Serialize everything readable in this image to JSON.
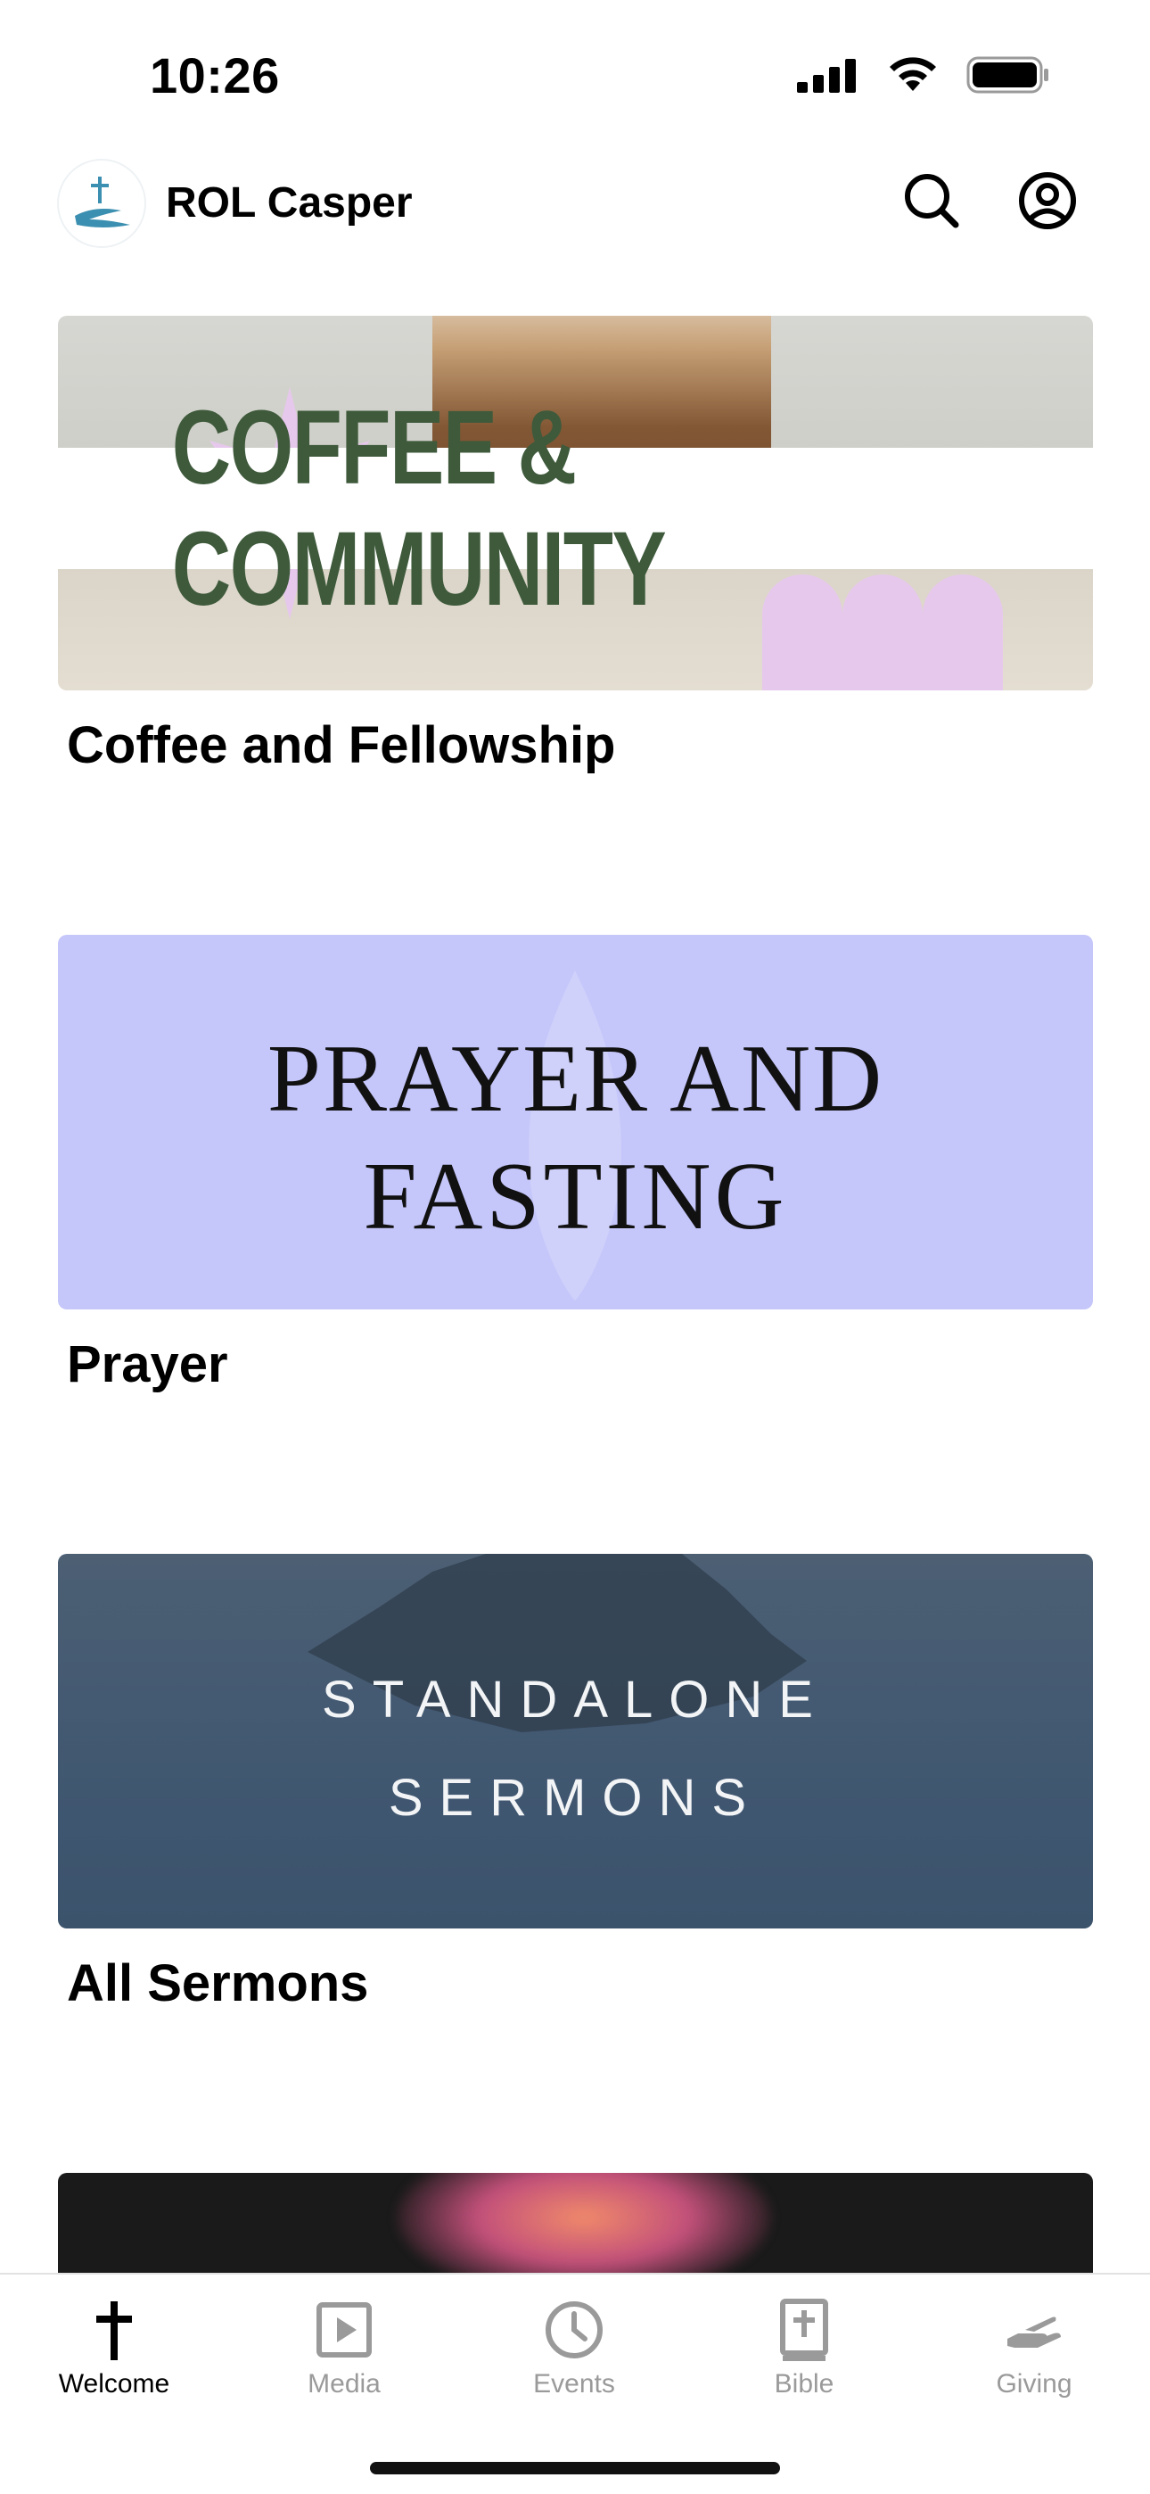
{
  "status_bar": {
    "time": "10:26"
  },
  "header": {
    "app_title": "ROL Casper",
    "logo_icon": "church-cross-logo-icon",
    "search_icon": "search-icon",
    "profile_icon": "account-icon"
  },
  "feed": {
    "items": [
      {
        "image_text": "COFFEE & COMMUNITY",
        "title": "Coffee and Fellowship"
      },
      {
        "image_text_line1": "PRAYER AND",
        "image_text_line2": "FASTING",
        "title": "Prayer"
      },
      {
        "image_text_line1": "STANDALONE",
        "image_text_line2": "SERMONS",
        "title": "All Sermons"
      },
      {
        "title": ""
      }
    ]
  },
  "tabs": [
    {
      "label": "Welcome",
      "icon": "cross-icon",
      "active": true
    },
    {
      "label": "Media",
      "icon": "play-icon",
      "active": false
    },
    {
      "label": "Events",
      "icon": "clock-icon",
      "active": false
    },
    {
      "label": "Bible",
      "icon": "bible-icon",
      "active": false
    },
    {
      "label": "Giving",
      "icon": "giving-hand-icon",
      "active": false
    }
  ],
  "colors": {
    "active_tab": "#000000",
    "inactive_tab": "#9a9a9a",
    "prayer_bg": "#c5c6fa",
    "coffee_text": "#3e5a3b"
  }
}
